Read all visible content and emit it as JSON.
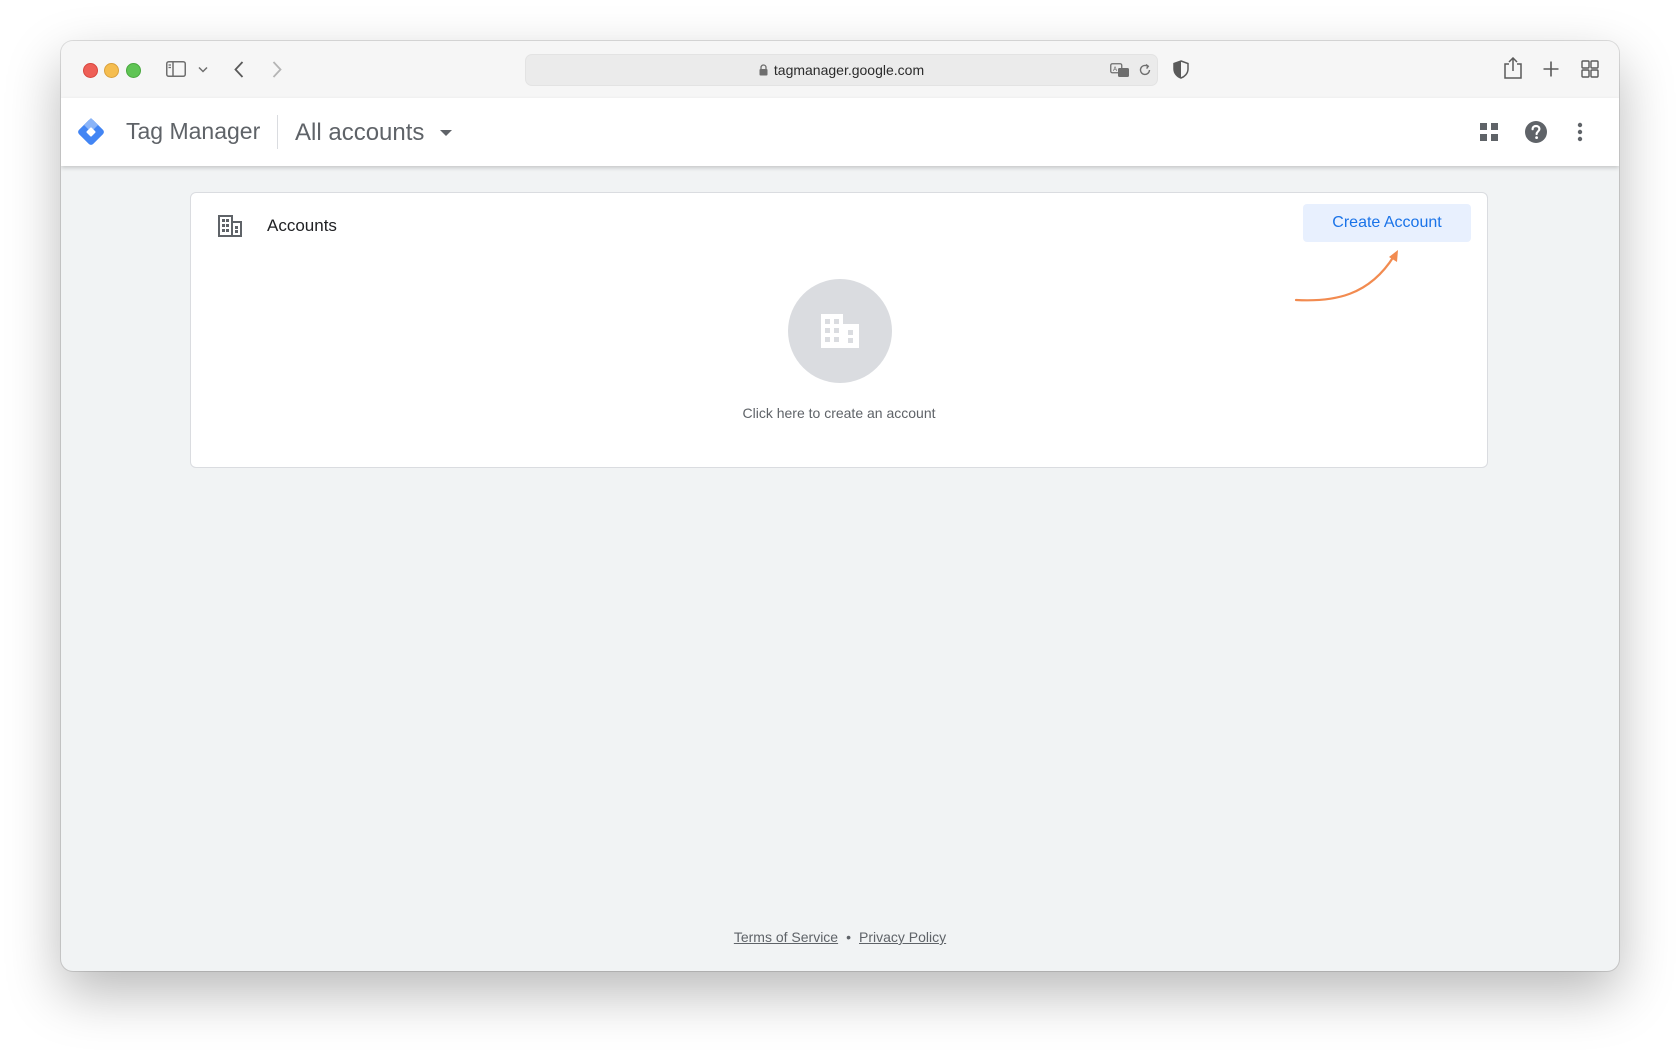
{
  "browser": {
    "url": "tagmanager.google.com"
  },
  "appbar": {
    "product_name": "Tag Manager",
    "account_picker_label": "All accounts"
  },
  "card": {
    "title": "Accounts",
    "create_button_label": "Create Account",
    "empty_state_text": "Click here to create an account"
  },
  "footer": {
    "terms_label": "Terms of Service",
    "separator": "•",
    "privacy_label": "Privacy Policy"
  },
  "colors": {
    "accent": "#1a73e8",
    "accent_bg": "#e8f0fe",
    "annotation_arrow": "#f28b50",
    "page_bg": "#f1f3f4"
  },
  "icons": [
    "sidebar-icon",
    "chevron-down-icon",
    "back-icon",
    "forward-icon",
    "lock-icon",
    "translate-icon",
    "reload-icon",
    "privacy-shield-icon",
    "share-icon",
    "new-tab-icon",
    "tab-overview-icon",
    "gtm-logo-icon",
    "apps-grid-icon",
    "help-icon",
    "more-vert-icon",
    "building-icon"
  ]
}
